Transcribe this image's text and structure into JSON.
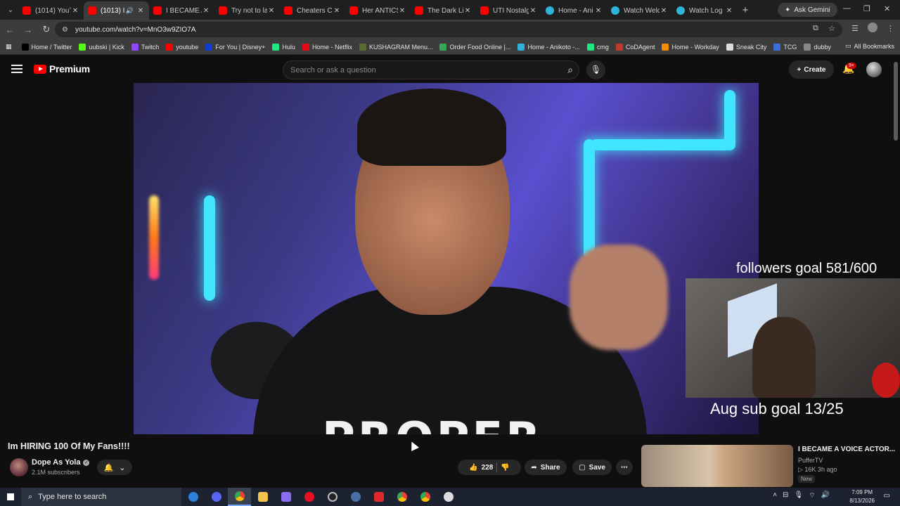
{
  "browser": {
    "tabs": [
      {
        "label": "(1014) YouTu",
        "favicon": "youtube-icon",
        "active": false
      },
      {
        "label": "(1013) I",
        "favicon": "youtube-icon",
        "active": true
      },
      {
        "label": "I BECAME A",
        "favicon": "youtube-icon",
        "active": false
      },
      {
        "label": "Try not to la",
        "favicon": "youtube-icon",
        "active": false
      },
      {
        "label": "Cheaters Co",
        "favicon": "youtube-icon",
        "active": false
      },
      {
        "label": "Her ANTICS",
        "favicon": "youtube-icon",
        "active": false
      },
      {
        "label": "The Dark Lif",
        "favicon": "youtube-icon",
        "active": false
      },
      {
        "label": "UTI Nostalgi",
        "favicon": "youtube-icon",
        "active": false
      },
      {
        "label": "Home - Ani",
        "favicon": "globe-icon",
        "active": false
      },
      {
        "label": "Watch Welc",
        "favicon": "globe-icon",
        "active": false
      },
      {
        "label": "Watch Log I",
        "favicon": "globe-icon",
        "active": false
      }
    ],
    "ask_gemini": "Ask Gemini",
    "url": "youtube.com/watch?v=MnO3w9ZIO7A",
    "bookmarks": [
      {
        "label": "Home / Twitter",
        "color": "#000000"
      },
      {
        "label": "uubski | Kick",
        "color": "#53fc18"
      },
      {
        "label": "Twitch",
        "color": "#9146ff"
      },
      {
        "label": "youtube",
        "color": "#ff0000"
      },
      {
        "label": "For You | Disney+",
        "color": "#113ccf"
      },
      {
        "label": "Hulu",
        "color": "#1ce783"
      },
      {
        "label": "Home - Netflix",
        "color": "#e50914"
      },
      {
        "label": "KUSHAGRAM Menu...",
        "color": "#556b2f"
      },
      {
        "label": "Order Food Online |...",
        "color": "#34a853"
      },
      {
        "label": "Home - Anikoto -...",
        "color": "#2fb4d9"
      },
      {
        "label": "cmg",
        "color": "#1ce783"
      },
      {
        "label": "CoDAgent",
        "color": "#c0392b"
      },
      {
        "label": "Home - Workday",
        "color": "#f38b00"
      },
      {
        "label": "Sneak City",
        "color": "#dddddd"
      },
      {
        "label": "TCG",
        "color": "#3b6fd8"
      },
      {
        "label": "dubby",
        "color": "#888888"
      }
    ],
    "all_bookmarks": "All Bookmarks"
  },
  "youtube": {
    "logo_text": "Premium",
    "search_placeholder": "Search or ask a question",
    "create_label": "Create",
    "notification_count": "9+"
  },
  "video": {
    "shirt_text": "PROPER"
  },
  "overlay": {
    "followers_goal": "followers goal 581/600",
    "sub_goal": "Aug sub goal 13/25"
  },
  "watch": {
    "title": "Im HIRING 100 Of My Fans!!!!",
    "channel": "Dope As Yola",
    "subscribers": "2.1M subscribers",
    "likes": "228",
    "share": "Share",
    "save": "Save"
  },
  "recommended": {
    "title": "I BECAME A VOICE ACTOR...",
    "channel": "PufferTV",
    "meta": "16K  3h ago",
    "badge": "New"
  },
  "taskbar": {
    "search_placeholder": "Type here to search",
    "time": "7:09 PM",
    "date": "8/13/2026"
  }
}
